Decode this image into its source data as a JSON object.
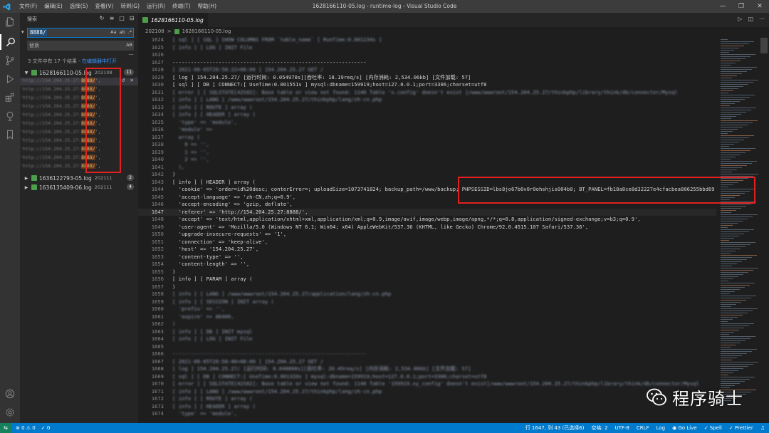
{
  "window": {
    "title": "1628166110-05.log - runtime-log - Visual Studio Code",
    "menu": [
      "文件(F)",
      "编辑(E)",
      "选择(S)",
      "查看(V)",
      "转到(G)",
      "运行(R)",
      "终端(T)",
      "帮助(H)"
    ]
  },
  "sidebar": {
    "header": "搜索",
    "search_value": "8888/",
    "search_opts": [
      "Aa",
      "ab",
      ".*"
    ],
    "replace_placeholder": "替换",
    "replace_opt": "AB",
    "summary": "3 文件中有 17 个结果 - ",
    "summary_link": "在编辑器中打开",
    "files": [
      {
        "name": "1628166110-05.log",
        "dir": "202108",
        "count": "11",
        "expanded": true
      },
      {
        "name": "1636122793-05.log",
        "dir": "202111",
        "count": "2",
        "expanded": false
      },
      {
        "name": "1636135409-06.log",
        "dir": "202111",
        "count": "4",
        "expanded": false
      }
    ],
    "match_suffix": "8888/",
    "match_count": 11
  },
  "editor": {
    "tab_label": "1628166110-05.log",
    "breadcrumb": [
      "202108",
      ">",
      "1628166110-05.log"
    ],
    "lines": [
      {
        "n": "1624",
        "t": "[ sql ] [ SQL ] SHOW COLUMNS FROM `table_name` [ RunTime:0.001234s ]",
        "blur": true
      },
      {
        "n": "1625",
        "t": "[ info ] [ LOG ] INIT File",
        "blur": true
      },
      {
        "n": "1626",
        "t": "",
        "blur": false
      },
      {
        "n": "1627",
        "t": "---------------------------------------------------------------",
        "blur": false
      },
      {
        "n": "1628",
        "t": "[ 2021-08-05T20:58:22+08:00 ] 154.204.25.27 GET /",
        "blur": true
      },
      {
        "n": "1629",
        "t": "[ log ] 154.204.25.27/ [运行时间: 0.054970s][吞吐率: 18.19req/s] [内存消耗: 2,534.06kb] [文件加载: 57]",
        "blur": false
      },
      {
        "n": "1630",
        "t": "[ sql ] [ DB ] CONNECT:[ UseTime:0.001551s ] mysql:dbname=159919;host=127.0.0.1;port=3306;charset=utf8",
        "blur": false
      },
      {
        "n": "1631",
        "t": "[ error ] [ SQLSTATE[42S02]: Base table or view not found: 1146 Table 'x.config' doesn't exist ]/www/wwwroot/154.204.25.27/thinkphp/library/think/db/connector/Mysql",
        "blur": true
      },
      {
        "n": "1632",
        "t": "[ info ] [ LANG ] /www/wwwroot/154.204.25.27/thinkphp/lang/zh-cn.php",
        "blur": true
      },
      {
        "n": "1633",
        "t": "[ info ] [ ROUTE ] array (",
        "blur": true
      },
      {
        "n": "1634",
        "t": "[ info ] [ HEADER ] array (",
        "blur": true
      },
      {
        "n": "1635",
        "t": "  'type' => 'module',",
        "blur": true
      },
      {
        "n": "1636",
        "t": "  'module' =>",
        "blur": true
      },
      {
        "n": "1637",
        "t": "  array (",
        "blur": true
      },
      {
        "n": "1638",
        "t": "    0 => '',",
        "blur": true
      },
      {
        "n": "1639",
        "t": "    1 => '',",
        "blur": true
      },
      {
        "n": "1640",
        "t": "    2 => '',",
        "blur": true
      },
      {
        "n": "1641",
        "t": "  ),",
        "blur": true
      },
      {
        "n": "1642",
        "t": ")",
        "blur": false
      },
      {
        "n": "1643",
        "t": "[ info ] [ HEADER ] array (",
        "blur": false
      },
      {
        "n": "1644",
        "t": "  'cookie' => 'order=id%20desc; conterError=; uploadSize=1073741824; backup_path=/www/backup; PHPSESSID=lbs8jo67b6v0r0ohshjis004b0; BT_PANEL=fb18a8ce8d32227e4cfacbea806255bbd69",
        "blur": false
      },
      {
        "n": "1645",
        "t": "  'accept-language' => 'zh-CN,zh;q=0.9',",
        "blur": false
      },
      {
        "n": "1646",
        "t": "  'accept-encoding' => 'gzip, deflate',",
        "blur": false
      },
      {
        "n": "1647",
        "t": "  'referer' => 'http://154.204.25.27:8888/',",
        "blur": false,
        "current": true
      },
      {
        "n": "1648",
        "t": "  'accept' => 'text/html,application/xhtml+xml,application/xml;q=0.9,image/avif,image/webp,image/apng,*/*;q=0.8,application/signed-exchange;v=b3;q=0.9',",
        "blur": false
      },
      {
        "n": "1649",
        "t": "  'user-agent' => 'Mozilla/5.0 (Windows NT 6.1; Win64; x64) AppleWebKit/537.36 (KHTML, like Gecko) Chrome/92.0.4515.107 Safari/537.36',",
        "blur": false
      },
      {
        "n": "1650",
        "t": "  'upgrade-insecure-requests' => '1',",
        "blur": false
      },
      {
        "n": "1651",
        "t": "  'connection' => 'keep-alive',",
        "blur": false
      },
      {
        "n": "1652",
        "t": "  'host' => '154.204.25.27',",
        "blur": false
      },
      {
        "n": "1653",
        "t": "  'content-type' => '',",
        "blur": false
      },
      {
        "n": "1654",
        "t": "  'content-length' => '',",
        "blur": false
      },
      {
        "n": "1655",
        "t": ")",
        "blur": false
      },
      {
        "n": "1656",
        "t": "[ info ] [ PARAM ] array (",
        "blur": false
      },
      {
        "n": "1657",
        "t": ")",
        "blur": false
      },
      {
        "n": "1658",
        "t": "[ info ] [ LANG ] /www/wwwroot/154.204.25.27/application/lang/zh-cn.php",
        "blur": true
      },
      {
        "n": "1659",
        "t": "[ info ] [ SESSION ] INIT array (",
        "blur": true
      },
      {
        "n": "1660",
        "t": "  'prefix' => '',",
        "blur": true
      },
      {
        "n": "1661",
        "t": "  'expire' => 86400,",
        "blur": true
      },
      {
        "n": "1662",
        "t": ")",
        "blur": true
      },
      {
        "n": "1663",
        "t": "[ info ] [ DB ] INIT mysql",
        "blur": true
      },
      {
        "n": "1664",
        "t": "[ info ] [ LOG ] INIT File",
        "blur": true
      },
      {
        "n": "1665",
        "t": "",
        "blur": false
      },
      {
        "n": "1666",
        "t": "---------------------------------------------------------------",
        "blur": true
      },
      {
        "n": "1667",
        "t": "[ 2021-08-05T20:58:40+08:00 ] 154.204.25.27 GET /",
        "blur": true
      },
      {
        "n": "1668",
        "t": "[ log ] 154.204.25.27/ [运行时间: 0.048800s][吞吐率: 20.49req/s] [内存消耗: 2,534.06kb] [文件加载: 57]",
        "blur": true
      },
      {
        "n": "1669",
        "t": "[ sql ] [ DB ] CONNECT:[ UseTime:0.001320s ] mysql:dbname=159919;host=127.0.0.1;port=3306;charset=utf8",
        "blur": true
      },
      {
        "n": "1670",
        "t": "[ error ] [ SQLSTATE[42S02]: Base table or view not found: 1146 Table '159919.xy_config' doesn't exist]/www/wwwroot/154.204.25.27/thinkphp/library/think/db/connector/Mysql",
        "blur": true
      },
      {
        "n": "1671",
        "t": "[ info ] [ LANG ] /www/wwwroot/154.204.25.27/thinkphp/lang/zh-cn.php",
        "blur": true
      },
      {
        "n": "1672",
        "t": "[ info ] [ ROUTE ] array (",
        "blur": true
      },
      {
        "n": "1673",
        "t": "[ info ] [ HEADER ] array (",
        "blur": true
      },
      {
        "n": "1674",
        "t": "  'type' => 'module',",
        "blur": true
      }
    ]
  },
  "statusbar": {
    "remote": "⇆",
    "problems": "⊗ 0 ⚠ 0",
    "ports": "✓ 0",
    "position": "行 1647, 列 43 (已选择6)",
    "spaces": "空格: 2",
    "encoding": "UTF-8",
    "eol": "CRLF",
    "language": "Log",
    "golive": "◉ Go Live",
    "spell": "✓ Spell",
    "prettier": "✓ Prettier"
  },
  "watermark": {
    "text": "程序骑士"
  },
  "colors": {
    "accent": "#007acc",
    "annotation": "#e0211f",
    "file_icon": "#4d9e4a"
  }
}
